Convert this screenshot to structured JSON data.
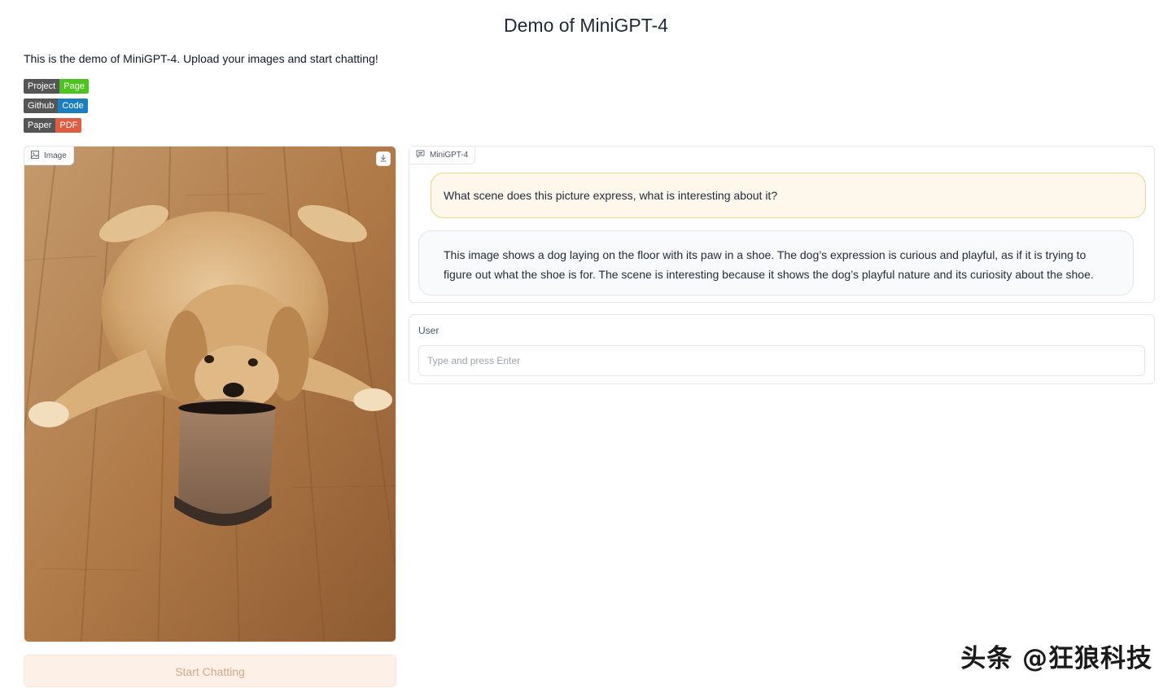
{
  "header": {
    "title": "Demo of MiniGPT-4",
    "intro": "This is the demo of MiniGPT-4. Upload your images and start chatting!"
  },
  "badges": [
    {
      "left": "Project",
      "right": "Page",
      "color": "#4bc51d"
    },
    {
      "left": "Github",
      "right": "Code",
      "color": "#1a7fc1"
    },
    {
      "left": "Paper",
      "right": "PDF",
      "color": "#e05d44"
    }
  ],
  "image_panel": {
    "label": "Image",
    "icon": "image-icon",
    "download_icon": "download-icon"
  },
  "start_button": {
    "label": "Start Chatting"
  },
  "chatbot": {
    "label": "MiniGPT-4",
    "icon": "chat-icon",
    "messages": [
      {
        "role": "user",
        "text": "What scene does this picture express, what is interesting about it?"
      },
      {
        "role": "bot",
        "text": "This image shows a dog laying on the floor with its paw in a shoe. The dog’s expression is curious and playful, as if it is trying to figure out what the shoe is for. The scene is interesting because it shows the dog’s playful nature and its curiosity about the shoe."
      }
    ]
  },
  "user_input": {
    "label": "User",
    "placeholder": "Type and press Enter",
    "value": ""
  },
  "watermark": "头条 @狂狼科技",
  "colors": {
    "accent": "#f3d38a",
    "button_bg": "#fdf1e7"
  }
}
